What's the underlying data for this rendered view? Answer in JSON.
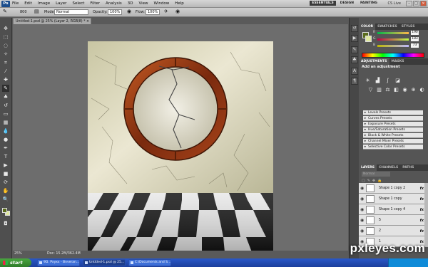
{
  "app": {
    "logo": "Ps",
    "menu": [
      "File",
      "Edit",
      "Image",
      "Layer",
      "Select",
      "Filter",
      "Analysis",
      "3D",
      "View",
      "Window",
      "Help"
    ],
    "workspaces": [
      "ESSENTIALS",
      "DESIGN",
      "PAINTING"
    ],
    "cs_live": "CS Live"
  },
  "options": {
    "brush_size": "800",
    "mode_label": "Mode:",
    "mode_value": "Normal",
    "opacity_label": "Opacity:",
    "opacity_value": "100%",
    "flow_label": "Flow:",
    "flow_value": "100%"
  },
  "document": {
    "tab_title": "Untitled-1.psd @ 25% (Layer 2, RGB/8) *",
    "close": "×"
  },
  "status": {
    "zoom": "25%",
    "doc_size": "Doc: 15.2M/362.4M"
  },
  "colors": {
    "foreground": "#5a6b1c",
    "background": "#dfe8a0"
  },
  "panels": {
    "color_tabs": [
      "COLOR",
      "SWATCHES",
      "STYLES"
    ],
    "sliders": [
      {
        "letter": "R",
        "value": "190"
      },
      {
        "letter": "G",
        "value": "183"
      },
      {
        "letter": "B",
        "value": "73"
      }
    ],
    "adjust_tabs": [
      "ADJUSTMENTS",
      "MASKS"
    ],
    "adjust_heading": "Add an adjustment",
    "presets": [
      "Levels Presets",
      "Curves Presets",
      "Exposure Presets",
      "Hue/Saturation Presets",
      "Black & White Presets",
      "Channel Mixer Presets",
      "Selective Color Presets"
    ],
    "layer_tabs": [
      "LAYERS",
      "CHANNELS",
      "PATHS"
    ],
    "blend_mode": "Normal",
    "layers": [
      {
        "name": "Shape 1 copy 2",
        "fx": "fx"
      },
      {
        "name": "Shape 1 copy",
        "fx": "fx"
      },
      {
        "name": "Shape 1 copy 4",
        "fx": "fx"
      },
      {
        "name": "5",
        "fx": "fx"
      },
      {
        "name": "2",
        "fx": "fx"
      },
      {
        "name": "1",
        "fx": "fx"
      }
    ]
  },
  "taskbar": {
    "start": "start",
    "tasks": [
      "9D. Pxyxx - Bnveran...",
      "Untitled-1.psd @ 25...",
      "C:\\Documents and S..."
    ]
  },
  "watermark": "pxleyes.com"
}
